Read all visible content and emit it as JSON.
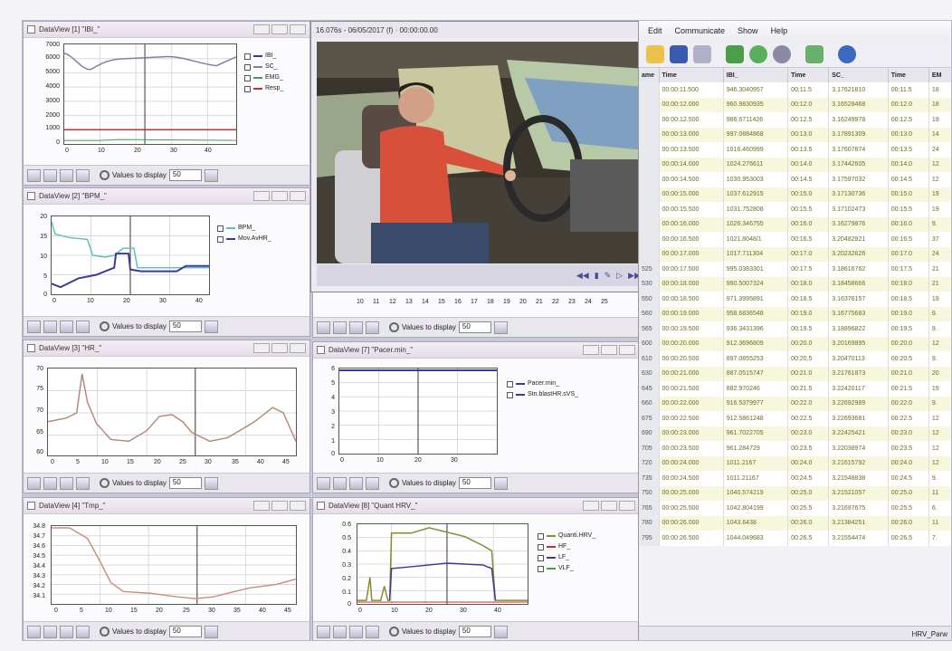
{
  "video": {
    "title": "16.076s - 06/05/2017 (f) · 00:00:00.00",
    "controls": [
      "◀◀",
      "▮",
      "✎",
      "▷",
      "▶▶"
    ]
  },
  "panels": [
    {
      "id": "p1",
      "title": "DataView [1] \"IBI_\"",
      "legend": [
        "IBI_",
        "SC_",
        "EMG_",
        "Resp_"
      ],
      "yticks": [
        "7000",
        "6000",
        "5000",
        "4000",
        "3000",
        "2000",
        "1000",
        "0"
      ],
      "xticks": [
        "0",
        "10",
        "20",
        "30",
        "40"
      ],
      "values_label": "Values to display",
      "values": "50"
    },
    {
      "id": "p2",
      "title": "DataView [2] \"BPM_\"",
      "legend": [
        "BPM_",
        "Mov.AvHR_"
      ],
      "yticks": [
        "20",
        "15",
        "10",
        "5",
        "0"
      ],
      "xticks": [
        "0",
        "10",
        "20",
        "30",
        "40"
      ],
      "values_label": "Values to display",
      "values": "50"
    },
    {
      "id": "p3",
      "title": "DataView [3] \"HR_\"",
      "legend": [],
      "yticks": [
        "70",
        "75",
        "70",
        "65",
        "60"
      ],
      "xticks": [
        "0",
        "5",
        "10",
        "15",
        "20",
        "25",
        "30",
        "35",
        "40",
        "45"
      ],
      "values_label": "Values to display",
      "values": "50"
    },
    {
      "id": "p4",
      "title": "DataView [4] \"Tmp_\"",
      "legend": [],
      "yticks": [
        "34.8",
        "34.7",
        "34.6",
        "34.5",
        "34.4",
        "34.3",
        "34.2",
        "34.1"
      ],
      "xticks": [
        "0",
        "5",
        "10",
        "15",
        "20",
        "25",
        "30",
        "35",
        "40",
        "45"
      ],
      "values_label": "Values to display",
      "values": "50"
    },
    {
      "id": "p5",
      "title": "",
      "legend": [],
      "yticks": [],
      "xticks": [
        "10",
        "11",
        "12",
        "13",
        "14",
        "15",
        "16",
        "17",
        "18",
        "19",
        "20",
        "21",
        "22",
        "23",
        "24",
        "25"
      ],
      "values_label": "Values to display",
      "values": "50"
    },
    {
      "id": "p6",
      "title": "DataView [7] \"Pacer.min_\"",
      "legend": [
        "Pacer.min_",
        "Stn.blastHR.sVS_"
      ],
      "yticks": [
        "6",
        "5",
        "4",
        "3",
        "2",
        "1",
        "0"
      ],
      "xticks": [
        "0",
        "10",
        "20",
        "30"
      ],
      "values_label": "Values to display",
      "values": "50"
    },
    {
      "id": "p7",
      "title": "DataView [8] \"Quant HRV_\"",
      "legend": [
        "Quanti.HRV_",
        "HF_",
        "LF_",
        "VLF_"
      ],
      "yticks": [
        "0.6",
        "0.5",
        "0.4",
        "0.3",
        "0.2",
        "0.1",
        "0"
      ],
      "xticks": [
        "0",
        "10",
        "20",
        "30",
        "40"
      ],
      "values_label": "Values to display",
      "values": "50"
    }
  ],
  "grid": {
    "menu": [
      "Edit",
      "Communicate",
      "Show",
      "Help"
    ],
    "columns": [
      "ame",
      "Time",
      "IBI_",
      "Time",
      "SC_",
      "Time",
      "EM"
    ],
    "rows": [
      [
        "",
        "00:00:11.500",
        "946.3040957",
        "00:11.5",
        "3.17621810",
        "00:11.5",
        "18"
      ],
      [
        "",
        "00:00:12.000",
        "960.9830935",
        "00:12.0",
        "3.16528468",
        "00:12.0",
        "18"
      ],
      [
        "",
        "00:00:12.500",
        "986.6711426",
        "00:12.5",
        "3.16249978",
        "00:12.5",
        "19"
      ],
      [
        "",
        "00:00:13.000",
        "997.0884868",
        "00:13.0",
        "3.17891309",
        "00:13.0",
        "14"
      ],
      [
        "",
        "00:00:13.500",
        "1016.460999",
        "00:13.5",
        "3.17607874",
        "00:13.5",
        "24"
      ],
      [
        "",
        "00:00:14.000",
        "1024.276611",
        "00:14.0",
        "3.17442605",
        "00:14.0",
        "12"
      ],
      [
        "",
        "00:00:14.500",
        "1030.953003",
        "00:14.5",
        "3.17597032",
        "00:14.5",
        "12"
      ],
      [
        "",
        "00:00:15.000",
        "1037.612915",
        "00:15.0",
        "3.17130736",
        "00:15.0",
        "19"
      ],
      [
        "",
        "00:00:15.500",
        "1031.752808",
        "00:15.5",
        "3.17102473",
        "00:15.5",
        "19"
      ],
      [
        "",
        "00:00:16.000",
        "1026.346755",
        "00:16.0",
        "3.16279876",
        "00:16.0",
        "9."
      ],
      [
        "",
        "00:00:16.500",
        "1021.8048/1",
        "00:16.5",
        "3.20482921",
        "00:16.5",
        "37"
      ],
      [
        "",
        "00:00:17.000",
        "1017.711304",
        "00:17.0",
        "3.20232626",
        "00:17.0",
        "24"
      ],
      [
        "525",
        "00:00:17.500",
        "995.0383301",
        "00:17.5",
        "3.18616762",
        "00:17.5",
        "21"
      ],
      [
        "530",
        "00:00:18.000",
        "990.5007324",
        "00:18.0",
        "3.18458666",
        "00:18.0",
        "21"
      ],
      [
        "550",
        "00:00:18.500",
        "971.3995891",
        "00:18.5",
        "3.16376157",
        "00:18.5",
        "19"
      ],
      [
        "560",
        "00:00:19.000",
        "958.6836548",
        "00:19.0",
        "3.16775683",
        "00:19.0",
        "9."
      ],
      [
        "565",
        "00:00:19.500",
        "936.3431396",
        "00:19.5",
        "3.18896822",
        "00:19.5",
        "9."
      ],
      [
        "600",
        "00:00:20.000",
        "912.3696809",
        "00:20.0",
        "3.20169895",
        "00:20.0",
        "12"
      ],
      [
        "610",
        "00:00:20.500",
        "897.0855253",
        "00:20.5",
        "3.20470113",
        "00:20.5",
        "9."
      ],
      [
        "630",
        "00:00:21.000",
        "887.0515747",
        "00:21.0",
        "3.21761873",
        "00:21.0",
        "20"
      ],
      [
        "645",
        "00:00:21.500",
        "882.970246",
        "00:21.5",
        "3.22420117",
        "00:21.5",
        "19"
      ],
      [
        "660",
        "00:00:22.000",
        "916.5379977",
        "00:22.0",
        "3.22692989",
        "00:22.0",
        "9."
      ],
      [
        "675",
        "00:00:22.500",
        "912.5861248",
        "00:22.5",
        "3.22693681",
        "00:22.5",
        "12"
      ],
      [
        "690",
        "00:00:23.000",
        "961.7022705",
        "00:23.0",
        "3.22425421",
        "00:23.0",
        "12"
      ],
      [
        "705",
        "00:00:23.500",
        "961.284729",
        "00:23.5",
        "3.22038974",
        "00:23.5",
        "12"
      ],
      [
        "720",
        "00:00:24.000",
        "1011.2167",
        "00:24.0",
        "3.21615792",
        "00:24.0",
        "12"
      ],
      [
        "735",
        "00:00:24.500",
        "1011.21167",
        "00:24.5",
        "3.21548838",
        "00:24.5",
        "9."
      ],
      [
        "750",
        "00:00:25.000",
        "1040.574219",
        "00:25.0",
        "3.21521057",
        "00:25.0",
        "11"
      ],
      [
        "765",
        "00:00:25.500",
        "1042.804199",
        "00:25.5",
        "3.21697675",
        "00:25.5",
        "6."
      ],
      [
        "780",
        "00:00:26.000",
        "1043.6438",
        "00:26.0",
        "3.21384251",
        "00:26.0",
        "11"
      ],
      [
        "795",
        "00:00:26.500",
        "1044.049683",
        "00:26.5",
        "3.21554474",
        "00:26.5",
        "7."
      ]
    ],
    "status": "HRV_Parw"
  },
  "accent": "#2d3e8c",
  "line_colors": {
    "blue": "#3a3a9a",
    "red": "#c03030",
    "teal": "#5fbfb0",
    "tan": "#b38a78",
    "olive": "#8a8a2a",
    "green": "#4d9a4d"
  }
}
